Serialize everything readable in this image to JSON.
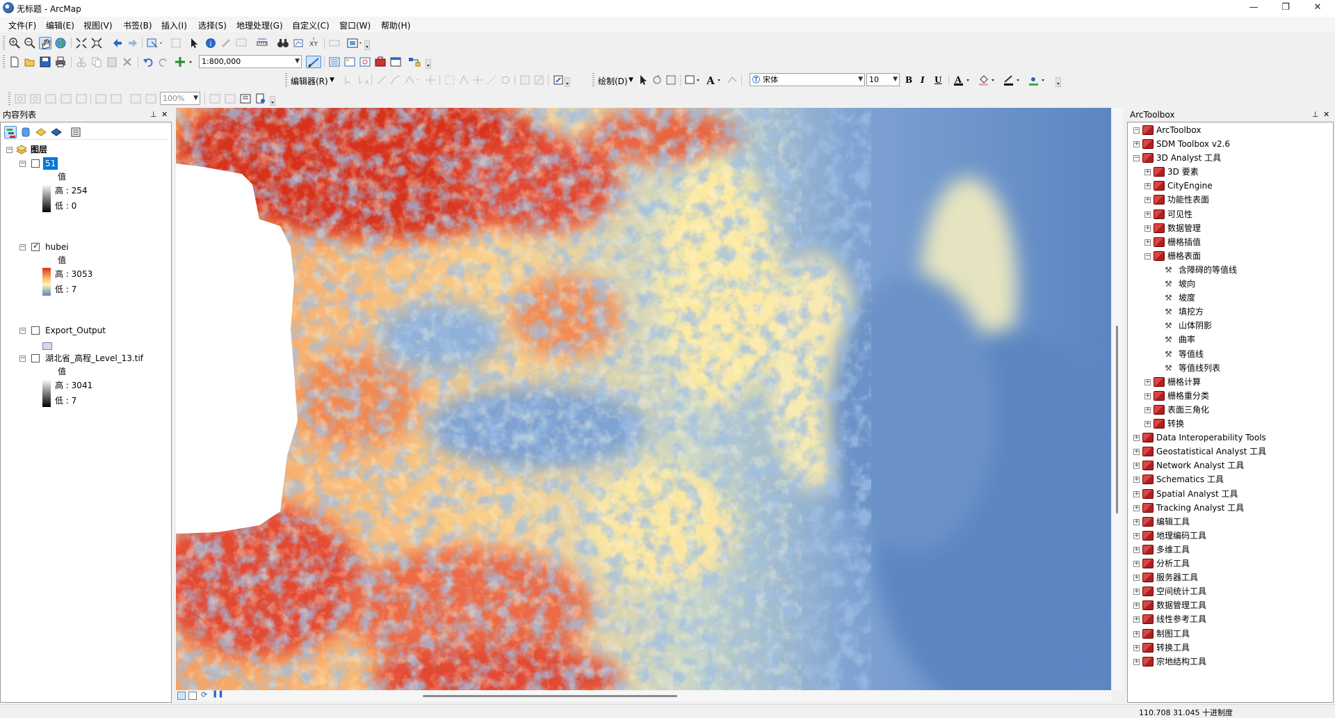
{
  "window": {
    "title": "无标题 - ArcMap",
    "minimize": "—",
    "maximize": "❐",
    "close": "✕"
  },
  "menu": [
    "文件(F)",
    "编辑(E)",
    "视图(V)",
    "书签(B)",
    "插入(I)",
    "选择(S)",
    "地理处理(G)",
    "自定义(C)",
    "窗口(W)",
    "帮助(H)"
  ],
  "toolbars": {
    "scale": "1:800,000",
    "editor_label": "编辑器(R)",
    "drawing_label": "绘制(D)",
    "font_name": "宋体",
    "font_size": "10",
    "bold": "B",
    "italic": "I",
    "underline": "U",
    "text_color_label": "A",
    "zoom_percent": "100%"
  },
  "toc": {
    "title": "内容列表",
    "root": "图层",
    "layers": [
      {
        "name": "51",
        "checked": false,
        "selected": true,
        "legend_title": "值",
        "high": "高 : 254",
        "low": "低 : 0",
        "ramp": "gray_rev"
      },
      {
        "name": "hubei",
        "checked": true,
        "selected": false,
        "legend_title": "值",
        "high": "高 : 3053",
        "low": "低 : 7",
        "ramp": "elev"
      },
      {
        "name": "Export_Output",
        "checked": false,
        "selected": false,
        "legend_title": "",
        "high": "",
        "low": "",
        "ramp": "fill"
      },
      {
        "name": "湖北省_高程_Level_13.tif",
        "checked": false,
        "selected": false,
        "legend_title": "值",
        "high": "高 : 3041",
        "low": "低 : 7",
        "ramp": "gray"
      }
    ]
  },
  "toolbox": {
    "title": "ArcToolbox",
    "root": "ArcToolbox",
    "items": [
      {
        "level": 1,
        "label": "SDM Toolbox v2.6",
        "kind": "box",
        "state": "+"
      },
      {
        "level": 1,
        "label": "3D Analyst 工具",
        "kind": "box",
        "state": "-"
      },
      {
        "level": 2,
        "label": "3D 要素",
        "kind": "set",
        "state": "+"
      },
      {
        "level": 2,
        "label": "CityEngine",
        "kind": "set",
        "state": "+"
      },
      {
        "level": 2,
        "label": "功能性表面",
        "kind": "set",
        "state": "+"
      },
      {
        "level": 2,
        "label": "可见性",
        "kind": "set",
        "state": "+"
      },
      {
        "level": 2,
        "label": "数据管理",
        "kind": "set",
        "state": "+"
      },
      {
        "level": 2,
        "label": "栅格插值",
        "kind": "set",
        "state": "+"
      },
      {
        "level": 2,
        "label": "栅格表面",
        "kind": "set",
        "state": "-"
      },
      {
        "level": 3,
        "label": "含障碍的等值线",
        "kind": "tool",
        "state": ""
      },
      {
        "level": 3,
        "label": "坡向",
        "kind": "tool",
        "state": ""
      },
      {
        "level": 3,
        "label": "坡度",
        "kind": "tool",
        "state": ""
      },
      {
        "level": 3,
        "label": "填挖方",
        "kind": "tool",
        "state": ""
      },
      {
        "level": 3,
        "label": "山体阴影",
        "kind": "tool",
        "state": ""
      },
      {
        "level": 3,
        "label": "曲率",
        "kind": "tool",
        "state": ""
      },
      {
        "level": 3,
        "label": "等值线",
        "kind": "tool",
        "state": ""
      },
      {
        "level": 3,
        "label": "等值线列表",
        "kind": "tool",
        "state": ""
      },
      {
        "level": 2,
        "label": "栅格计算",
        "kind": "set",
        "state": "+"
      },
      {
        "level": 2,
        "label": "栅格重分类",
        "kind": "set",
        "state": "+"
      },
      {
        "level": 2,
        "label": "表面三角化",
        "kind": "set",
        "state": "+"
      },
      {
        "level": 2,
        "label": "转换",
        "kind": "set",
        "state": "+"
      },
      {
        "level": 1,
        "label": "Data Interoperability Tools",
        "kind": "box",
        "state": "+"
      },
      {
        "level": 1,
        "label": "Geostatistical Analyst 工具",
        "kind": "box",
        "state": "+"
      },
      {
        "level": 1,
        "label": "Network Analyst 工具",
        "kind": "box",
        "state": "+"
      },
      {
        "level": 1,
        "label": "Schematics 工具",
        "kind": "box",
        "state": "+"
      },
      {
        "level": 1,
        "label": "Spatial Analyst 工具",
        "kind": "box",
        "state": "+"
      },
      {
        "level": 1,
        "label": "Tracking Analyst 工具",
        "kind": "box",
        "state": "+"
      },
      {
        "level": 1,
        "label": "编辑工具",
        "kind": "box",
        "state": "+"
      },
      {
        "level": 1,
        "label": "地理编码工具",
        "kind": "box",
        "state": "+"
      },
      {
        "level": 1,
        "label": "多维工具",
        "kind": "box",
        "state": "+"
      },
      {
        "level": 1,
        "label": "分析工具",
        "kind": "box",
        "state": "+"
      },
      {
        "level": 1,
        "label": "服务器工具",
        "kind": "box",
        "state": "+"
      },
      {
        "level": 1,
        "label": "空间统计工具",
        "kind": "box",
        "state": "+"
      },
      {
        "level": 1,
        "label": "数据管理工具",
        "kind": "box",
        "state": "+"
      },
      {
        "level": 1,
        "label": "线性参考工具",
        "kind": "box",
        "state": "+"
      },
      {
        "level": 1,
        "label": "制图工具",
        "kind": "box",
        "state": "+"
      },
      {
        "level": 1,
        "label": "转换工具",
        "kind": "box",
        "state": "+"
      },
      {
        "level": 1,
        "label": "宗地结构工具",
        "kind": "box",
        "state": "+"
      }
    ]
  },
  "statusbar": {
    "coords": "110.708  31.045 十进制度"
  },
  "colors": {
    "elev_high": "#d7301f",
    "elev_mid": "#fdf5b8",
    "elev_low": "#5b86c2",
    "selection": "#0078d7"
  }
}
